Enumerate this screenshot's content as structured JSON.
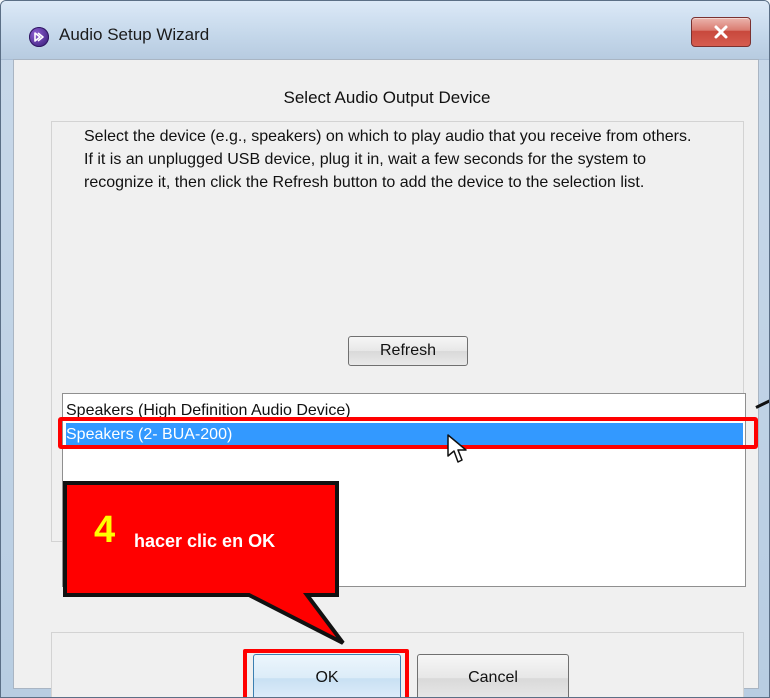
{
  "window": {
    "title": "Audio Setup Wizard",
    "close_icon": "close-icon"
  },
  "heading": "Select Audio Output Device",
  "description": "Select the device (e.g., speakers) on which to play audio that you receive from others. If it is an unplugged USB device, plug it in, wait a few seconds for the system to recognize it, then click the Refresh button to add the device to the selection list.",
  "refresh_button": "Refresh",
  "devices": [
    {
      "label": "Speakers (High Definition Audio Device)",
      "selected": false
    },
    {
      "label": "Speakers (2- BUA-200)",
      "selected": true
    }
  ],
  "callout": {
    "step_number": "4",
    "text": "hacer clic en OK"
  },
  "buttons": {
    "ok": "OK",
    "cancel": "Cancel"
  },
  "colors": {
    "highlight_red": "#ff0000",
    "selection_blue": "#3399ff",
    "callout_yellow": "#ffff00"
  },
  "icons": {
    "app": "app-icon",
    "cursor": "cursor-icon"
  }
}
